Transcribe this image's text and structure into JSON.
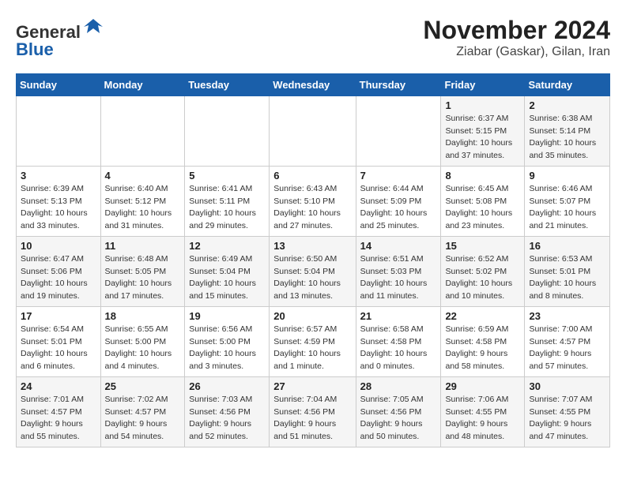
{
  "header": {
    "logo_line1": "General",
    "logo_line2": "Blue",
    "main_title": "November 2024",
    "subtitle": "Ziabar (Gaskar), Gilan, Iran"
  },
  "weekdays": [
    "Sunday",
    "Monday",
    "Tuesday",
    "Wednesday",
    "Thursday",
    "Friday",
    "Saturday"
  ],
  "weeks": [
    [
      {
        "day": "",
        "detail": ""
      },
      {
        "day": "",
        "detail": ""
      },
      {
        "day": "",
        "detail": ""
      },
      {
        "day": "",
        "detail": ""
      },
      {
        "day": "",
        "detail": ""
      },
      {
        "day": "1",
        "detail": "Sunrise: 6:37 AM\nSunset: 5:15 PM\nDaylight: 10 hours and 37 minutes."
      },
      {
        "day": "2",
        "detail": "Sunrise: 6:38 AM\nSunset: 5:14 PM\nDaylight: 10 hours and 35 minutes."
      }
    ],
    [
      {
        "day": "3",
        "detail": "Sunrise: 6:39 AM\nSunset: 5:13 PM\nDaylight: 10 hours and 33 minutes."
      },
      {
        "day": "4",
        "detail": "Sunrise: 6:40 AM\nSunset: 5:12 PM\nDaylight: 10 hours and 31 minutes."
      },
      {
        "day": "5",
        "detail": "Sunrise: 6:41 AM\nSunset: 5:11 PM\nDaylight: 10 hours and 29 minutes."
      },
      {
        "day": "6",
        "detail": "Sunrise: 6:43 AM\nSunset: 5:10 PM\nDaylight: 10 hours and 27 minutes."
      },
      {
        "day": "7",
        "detail": "Sunrise: 6:44 AM\nSunset: 5:09 PM\nDaylight: 10 hours and 25 minutes."
      },
      {
        "day": "8",
        "detail": "Sunrise: 6:45 AM\nSunset: 5:08 PM\nDaylight: 10 hours and 23 minutes."
      },
      {
        "day": "9",
        "detail": "Sunrise: 6:46 AM\nSunset: 5:07 PM\nDaylight: 10 hours and 21 minutes."
      }
    ],
    [
      {
        "day": "10",
        "detail": "Sunrise: 6:47 AM\nSunset: 5:06 PM\nDaylight: 10 hours and 19 minutes."
      },
      {
        "day": "11",
        "detail": "Sunrise: 6:48 AM\nSunset: 5:05 PM\nDaylight: 10 hours and 17 minutes."
      },
      {
        "day": "12",
        "detail": "Sunrise: 6:49 AM\nSunset: 5:04 PM\nDaylight: 10 hours and 15 minutes."
      },
      {
        "day": "13",
        "detail": "Sunrise: 6:50 AM\nSunset: 5:04 PM\nDaylight: 10 hours and 13 minutes."
      },
      {
        "day": "14",
        "detail": "Sunrise: 6:51 AM\nSunset: 5:03 PM\nDaylight: 10 hours and 11 minutes."
      },
      {
        "day": "15",
        "detail": "Sunrise: 6:52 AM\nSunset: 5:02 PM\nDaylight: 10 hours and 10 minutes."
      },
      {
        "day": "16",
        "detail": "Sunrise: 6:53 AM\nSunset: 5:01 PM\nDaylight: 10 hours and 8 minutes."
      }
    ],
    [
      {
        "day": "17",
        "detail": "Sunrise: 6:54 AM\nSunset: 5:01 PM\nDaylight: 10 hours and 6 minutes."
      },
      {
        "day": "18",
        "detail": "Sunrise: 6:55 AM\nSunset: 5:00 PM\nDaylight: 10 hours and 4 minutes."
      },
      {
        "day": "19",
        "detail": "Sunrise: 6:56 AM\nSunset: 5:00 PM\nDaylight: 10 hours and 3 minutes."
      },
      {
        "day": "20",
        "detail": "Sunrise: 6:57 AM\nSunset: 4:59 PM\nDaylight: 10 hours and 1 minute."
      },
      {
        "day": "21",
        "detail": "Sunrise: 6:58 AM\nSunset: 4:58 PM\nDaylight: 10 hours and 0 minutes."
      },
      {
        "day": "22",
        "detail": "Sunrise: 6:59 AM\nSunset: 4:58 PM\nDaylight: 9 hours and 58 minutes."
      },
      {
        "day": "23",
        "detail": "Sunrise: 7:00 AM\nSunset: 4:57 PM\nDaylight: 9 hours and 57 minutes."
      }
    ],
    [
      {
        "day": "24",
        "detail": "Sunrise: 7:01 AM\nSunset: 4:57 PM\nDaylight: 9 hours and 55 minutes."
      },
      {
        "day": "25",
        "detail": "Sunrise: 7:02 AM\nSunset: 4:57 PM\nDaylight: 9 hours and 54 minutes."
      },
      {
        "day": "26",
        "detail": "Sunrise: 7:03 AM\nSunset: 4:56 PM\nDaylight: 9 hours and 52 minutes."
      },
      {
        "day": "27",
        "detail": "Sunrise: 7:04 AM\nSunset: 4:56 PM\nDaylight: 9 hours and 51 minutes."
      },
      {
        "day": "28",
        "detail": "Sunrise: 7:05 AM\nSunset: 4:56 PM\nDaylight: 9 hours and 50 minutes."
      },
      {
        "day": "29",
        "detail": "Sunrise: 7:06 AM\nSunset: 4:55 PM\nDaylight: 9 hours and 48 minutes."
      },
      {
        "day": "30",
        "detail": "Sunrise: 7:07 AM\nSunset: 4:55 PM\nDaylight: 9 hours and 47 minutes."
      }
    ]
  ]
}
